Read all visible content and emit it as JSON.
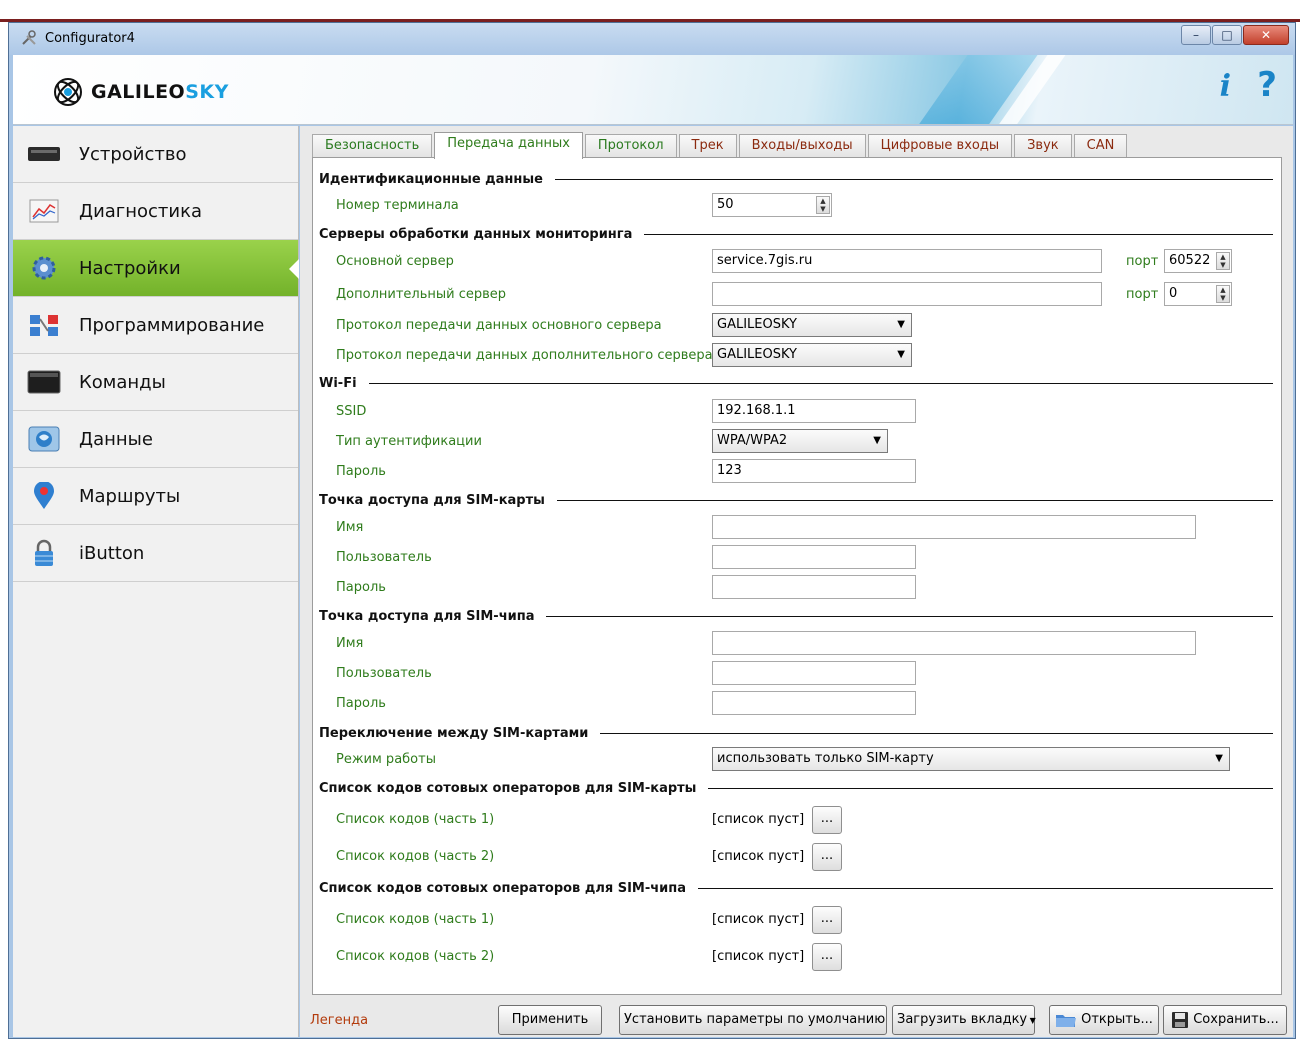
{
  "window": {
    "title": "Configurator4",
    "controls": {
      "minimize": "–",
      "maximize": "□",
      "close": "✕"
    }
  },
  "header": {
    "logo_text_main": "GALILEO",
    "logo_text_accent": "SKY",
    "info_label": "i",
    "help_label": "?"
  },
  "sidebar": {
    "items": [
      {
        "label": "Устройство",
        "icon": "device-icon",
        "active": false
      },
      {
        "label": "Диагностика",
        "icon": "diagnostics-chart-icon",
        "active": false
      },
      {
        "label": "Настройки",
        "icon": "gear-icon",
        "active": true
      },
      {
        "label": "Программирование",
        "icon": "programming-icon",
        "active": false
      },
      {
        "label": "Команды",
        "icon": "terminal-icon",
        "active": false
      },
      {
        "label": "Данные",
        "icon": "data-icon",
        "active": false
      },
      {
        "label": "Маршруты",
        "icon": "map-pin-icon",
        "active": false
      },
      {
        "label": "iButton",
        "icon": "lock-icon",
        "active": false
      }
    ]
  },
  "tabs": [
    {
      "label": "Безопасность",
      "color": "green"
    },
    {
      "label": "Передача данных",
      "color": "green",
      "active": true
    },
    {
      "label": "Протокол",
      "color": "green"
    },
    {
      "label": "Трек",
      "color": "red"
    },
    {
      "label": "Входы/выходы",
      "color": "red"
    },
    {
      "label": "Цифровые входы",
      "color": "red"
    },
    {
      "label": "Звук",
      "color": "red"
    },
    {
      "label": "CAN",
      "color": "red"
    }
  ],
  "sections": {
    "ident": {
      "title": "Идентификационные данные",
      "terminal_label": "Номер терминала",
      "terminal_value": "50"
    },
    "servers": {
      "title": "Серверы обработки данных мониторинга",
      "main_label": "Основной сервер",
      "main_value": "service.7gis.ru",
      "main_port_label": "порт",
      "main_port_value": "60522",
      "extra_label": "Дополнительный сервер",
      "extra_value": "",
      "extra_port_label": "порт",
      "extra_port_value": "0",
      "proto_main_label": "Протокол передачи данных основного сервера",
      "proto_main_value": "GALILEOSKY",
      "proto_extra_label": "Протокол передачи данных дополнительного сервера",
      "proto_extra_value": "GALILEOSKY"
    },
    "wifi": {
      "title": "Wi-Fi",
      "ssid_label": "SSID",
      "ssid_value": "192.168.1.1",
      "auth_label": "Тип аутентификации",
      "auth_value": "WPA/WPA2",
      "pass_label": "Пароль",
      "pass_value": "123"
    },
    "apn_card": {
      "title": "Точка доступа для SIM-карты",
      "name_label": "Имя",
      "name_value": "",
      "user_label": "Пользователь",
      "user_value": "",
      "pass_label": "Пароль",
      "pass_value": ""
    },
    "apn_chip": {
      "title": "Точка доступа для SIM-чипа",
      "name_label": "Имя",
      "name_value": "",
      "user_label": "Пользователь",
      "user_value": "",
      "pass_label": "Пароль",
      "pass_value": ""
    },
    "sim_switch": {
      "title": "Переключение между SIM-картами",
      "mode_label": "Режим работы",
      "mode_value": "использовать только SIM-карту"
    },
    "codes_card": {
      "title": "Список кодов сотовых операторов для SIM-карты",
      "part1_label": "Список кодов (часть 1)",
      "part1_value": "[список пуст]",
      "part2_label": "Список кодов (часть 2)",
      "part2_value": "[список пуст]",
      "dots": "..."
    },
    "codes_chip": {
      "title": "Список кодов сотовых операторов для SIM-чипа",
      "part1_label": "Список кодов (часть 1)",
      "part1_value": "[список пуст]",
      "part2_label": "Список кодов (часть 2)",
      "part2_value": "[список пуст]",
      "dots": "..."
    }
  },
  "footer": {
    "legend": "Легенда",
    "apply": "Применить",
    "defaults": "Установить параметры по умолчанию",
    "load_tab": "Загрузить вкладку",
    "open": "Открыть...",
    "save": "Сохранить..."
  },
  "colors": {
    "label_green": "#2f7c1c",
    "tab_red": "#8b2a0f",
    "active_nav": "#85c13a",
    "accent_blue": "#1a84c7"
  }
}
